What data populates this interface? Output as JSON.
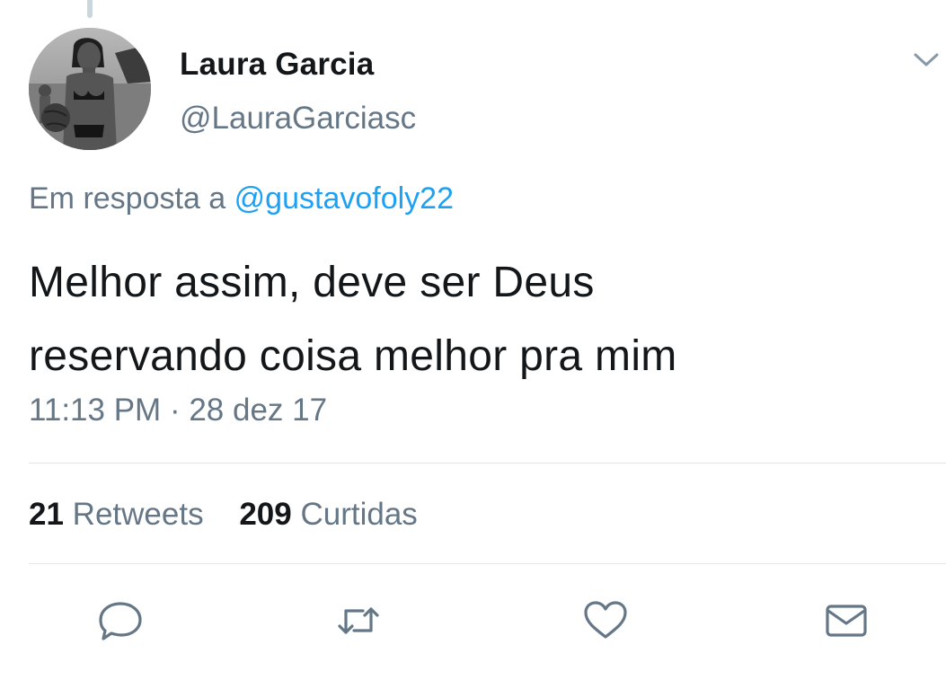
{
  "tweet": {
    "author": {
      "display_name": "Laura Garcia",
      "handle": "@LauraGarciasc"
    },
    "reply_prefix": "Em resposta a",
    "reply_to_handle": "@gustavofoly22",
    "text_lines": [
      "Melhor assim, deve ser Deus",
      "reservando coisa melhor pra mim"
    ],
    "time": "11:13 PM",
    "separator": "·",
    "date": "28 dez 17",
    "stats": {
      "retweets_count": "21",
      "retweets_label": "Retweets",
      "likes_count": "209",
      "likes_label": "Curtidas"
    }
  },
  "icons": {
    "menu": "chevron-down-icon",
    "reply": "reply-bubble-icon",
    "retweet": "retweet-icon",
    "like": "heart-icon",
    "share": "envelope-icon"
  },
  "colors": {
    "text": "#14171a",
    "secondary": "#657786",
    "link": "#1da1f2",
    "divider": "#e1e8ed"
  }
}
